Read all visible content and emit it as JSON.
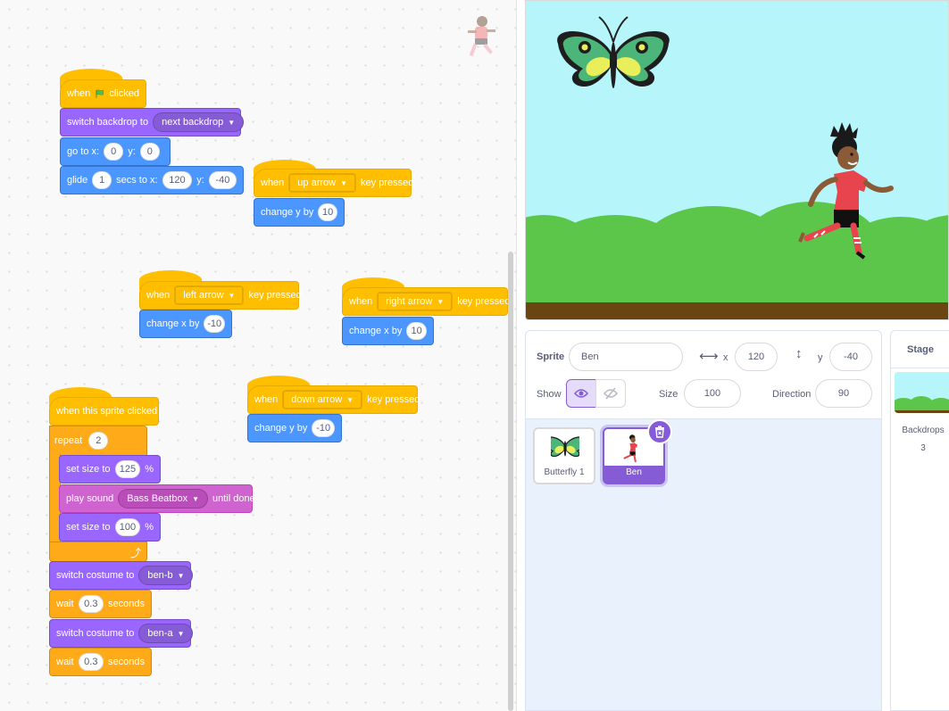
{
  "scripts": {
    "flag": {
      "when": "when",
      "clicked": "clicked",
      "switch_backdrop": "switch backdrop to",
      "backdrop_value": "next backdrop",
      "goto_label": "go to x:",
      "goto_x": "0",
      "y_label": "y:",
      "goto_y": "0",
      "glide_label": "glide",
      "glide_secs": "1",
      "secs_to_x": "secs to x:",
      "glide_x": "120",
      "glide_y": "-40"
    },
    "up": {
      "when": "when",
      "key": "up arrow",
      "pressed": "key pressed",
      "action": "change y by",
      "value": "10"
    },
    "left": {
      "when": "when",
      "key": "left arrow",
      "pressed": "key pressed",
      "action": "change x by",
      "value": "-10"
    },
    "right": {
      "when": "when",
      "key": "right arrow",
      "pressed": "key pressed",
      "action": "change x by",
      "value": "10"
    },
    "down": {
      "when": "when",
      "key": "down arrow",
      "pressed": "key pressed",
      "action": "change y by",
      "value": "-10"
    },
    "sprite_click": {
      "hat": "when this sprite clicked",
      "repeat": "repeat",
      "repeat_count": "2",
      "set_size": "set size to",
      "size1": "125",
      "percent": "%",
      "play_sound": "play sound",
      "sound": "Bass Beatbox",
      "until_done": "until done",
      "size2": "100",
      "switch_costume": "switch costume to",
      "costume1": "ben-b",
      "wait": "wait",
      "wait1": "0.3",
      "seconds": "seconds",
      "costume2": "ben-a",
      "wait2": "0.3"
    }
  },
  "sprite_info": {
    "sprite_label": "Sprite",
    "sprite_name": "Ben",
    "x_label": "x",
    "x_value": "120",
    "y_label": "y",
    "y_value": "-40",
    "show_label": "Show",
    "size_label": "Size",
    "size_value": "100",
    "direction_label": "Direction",
    "direction_value": "90"
  },
  "sprites": [
    {
      "name": "Butterfly 1",
      "selected": false
    },
    {
      "name": "Ben",
      "selected": true
    }
  ],
  "stage_pane": {
    "title": "Stage",
    "backdrops_label": "Backdrops",
    "backdrops_count": "3"
  },
  "colors": {
    "events": "#ffbf00",
    "looks": "#9966ff",
    "motion": "#4c97ff",
    "control": "#ffab19",
    "sound": "#cf63cf",
    "selected": "#855cd6",
    "stage_sky": "#b6f6fb",
    "hills": "#5cc64a",
    "ground": "#6b4511"
  },
  "icons": [
    "green-flag-icon",
    "dropdown-caret-icon",
    "loop-arrow-icon",
    "horizontal-arrows-icon",
    "vertical-arrows-icon",
    "eye-icon",
    "eye-slash-icon",
    "trash-icon"
  ]
}
